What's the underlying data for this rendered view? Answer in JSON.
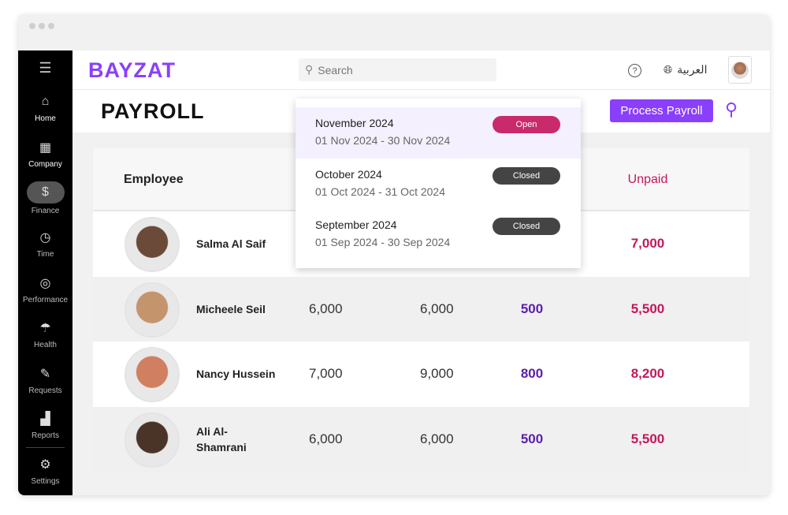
{
  "brand": {
    "logo": "BAYZAT",
    "accent": "#8a3ffc"
  },
  "header": {
    "search_placeholder": "Search",
    "language": "العربية"
  },
  "sidebar": {
    "items": [
      {
        "label": "Home",
        "icon": "home-icon"
      },
      {
        "label": "Company",
        "icon": "building-icon"
      },
      {
        "label": "Finance",
        "icon": "dollar-icon",
        "active": true
      },
      {
        "label": "Time",
        "icon": "clock-icon"
      },
      {
        "label": "Performance",
        "icon": "target-icon"
      },
      {
        "label": "Health",
        "icon": "umbrella-icon"
      },
      {
        "label": "Requests",
        "icon": "clipboard-icon"
      },
      {
        "label": "Reports",
        "icon": "chart-icon"
      },
      {
        "label": "Settings",
        "icon": "gear-icon"
      }
    ]
  },
  "page": {
    "title": "PAYROLL",
    "process_button": "Process Payroll"
  },
  "table": {
    "headers": {
      "employee": "Employee",
      "unpaid": "Unpaid"
    },
    "rows": [
      {
        "name": "Salma Al Saif",
        "c2": "",
        "c3": "",
        "c4": "",
        "unpaid": "7,000"
      },
      {
        "name": "Micheele Seil",
        "c2": "6,000",
        "c3": "6,000",
        "c4": "500",
        "unpaid": "5,500"
      },
      {
        "name": "Nancy Hussein",
        "c2": "7,000",
        "c3": "9,000",
        "c4": "800",
        "unpaid": "8,200"
      },
      {
        "name": "Ali Al-\nShamrani",
        "c2": "6,000",
        "c3": "6,000",
        "c4": "500",
        "unpaid": "5,500"
      }
    ]
  },
  "periods": [
    {
      "month": "November 2024",
      "range": "01 Nov 2024 - 30 Nov 2024",
      "status": "Open",
      "color": "#c92a6b"
    },
    {
      "month": "October 2024",
      "range": "01 Oct 2024 - 31 Oct 2024",
      "status": "Closed",
      "color": "#444444"
    },
    {
      "month": "September 2024",
      "range": "01 Sep 2024 - 30 Sep 2024",
      "status": "Closed",
      "color": "#444444"
    }
  ]
}
